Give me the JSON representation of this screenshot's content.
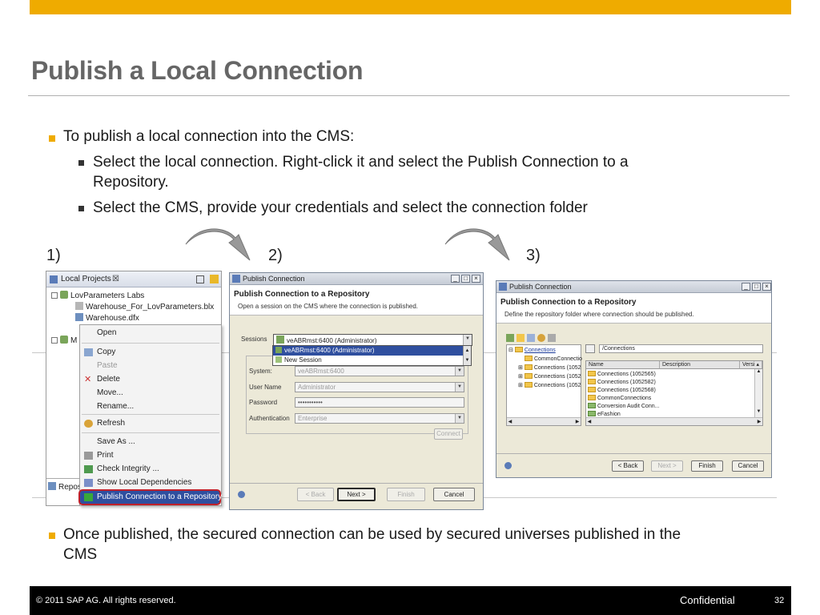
{
  "slide": {
    "title": "Publish a Local Connection",
    "bullet1": "To publish a local connection into the CMS:",
    "sub1a": "Select the local connection. Right-click it and select the Publish Connection to a",
    "sub1b": "Repository.",
    "sub2": "Select the CMS, provide your credentials and select the connection folder",
    "step1": "1)",
    "step2": "2)",
    "step3": "3)",
    "bullet2a": "Once published, the secured connection can be used by secured universes published in the",
    "bullet2b": "CMS"
  },
  "panel1": {
    "tab_label": "Local Projects",
    "tab_close": "☒",
    "tree": [
      "LovParameters Labs",
      "Warehouse_For_LovParameters.blx",
      "Warehouse.dfx"
    ],
    "bottom_tab": "Repos",
    "menu": {
      "open": "Open",
      "copy": "Copy",
      "paste": "Paste",
      "delete": "Delete",
      "move": "Move...",
      "rename": "Rename...",
      "refresh": "Refresh",
      "save_as": "Save As ...",
      "print": "Print",
      "check_integrity": "Check Integrity ...",
      "show_local_deps": "Show Local Dependencies",
      "publish": "Publish Connection to a Repository"
    }
  },
  "panel2": {
    "window_title": "Publish Connection",
    "heading": "Publish Connection to a Repository",
    "subheading": "Open a session on the CMS where the connection is published.",
    "sessions_label": "Sessions",
    "sessions_value": "veABRmst:6400 (Administrator)",
    "dropdown_options": [
      "veABRmst:6400 (Administrator)",
      "New Session"
    ],
    "system_label": "System:",
    "system_value": "veABRmst:6400",
    "user_label": "User Name",
    "user_value": "Administrator",
    "password_label": "Password",
    "password_value": "•••••••••••",
    "auth_label": "Authentication",
    "auth_value": "Enterprise",
    "connect_btn": "Connect",
    "back_btn": "< Back",
    "next_btn": "Next >",
    "finish_btn": "Finish",
    "cancel_btn": "Cancel"
  },
  "panel3": {
    "window_title": "Publish Connection",
    "heading": "Publish Connection to a Repository",
    "subheading": "Define the repository folder where connection should be published.",
    "tree": [
      "Connections",
      "CommonConnectio",
      "Connections (1052",
      "Connections (1052",
      "Connections (1052"
    ],
    "path": "/Connections",
    "columns": [
      "Name",
      "Description",
      "Versi"
    ],
    "rows": [
      "Connections (1052565)",
      "Connections (1052582)",
      "Connections (1052568)",
      "CommonConnections",
      "Conversion Audit Conn...",
      "eFashion"
    ],
    "back_btn": "< Back",
    "next_btn": "Next >",
    "finish_btn": "Finish",
    "cancel_btn": "Cancel"
  },
  "footer": {
    "copyright": "© 2011 SAP AG. All rights reserved.",
    "confidential": "Confidential",
    "page": "32"
  },
  "colors": {
    "accent": "#efab00",
    "title": "#666666",
    "highlight": "#2f4f9f",
    "outline": "#c0202a"
  }
}
